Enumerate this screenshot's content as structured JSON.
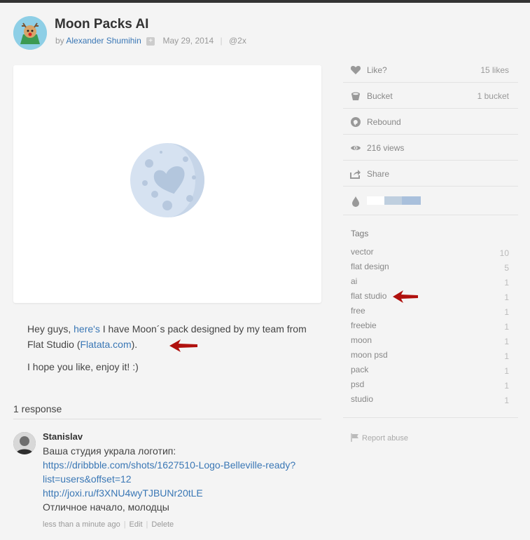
{
  "shot": {
    "title": "Moon Packs AI",
    "by_label": "by",
    "author": "Alexander Shumihin",
    "date": "May 29, 2014",
    "resolution": "@2x"
  },
  "description": {
    "p1_before": "Hey guys, ",
    "p1_link": "here's",
    "p1_middle": " I have Moon´s pack designed by my team from Flat Studio (",
    "p1_link2": "Flatata.com",
    "p1_after": ").",
    "p2": "I hope you like, enjoy it! :)"
  },
  "responses": {
    "count_label": "1 response",
    "comment": {
      "name": "Stanislav",
      "line1": "Ваша студия украла логотип:",
      "link1a": "https://dribbble.com/shots/1627510-Logo-Belleville-ready?",
      "link1b": "list=users&offset=12",
      "link2": "http://joxi.ru/f3XNU4wyTJBUNr20tLE",
      "line2": "Отличное начало, молодцы",
      "time": "less than a minute ago",
      "edit": "Edit",
      "delete": "Delete"
    }
  },
  "sidebar": {
    "like": {
      "label": "Like?",
      "value": "15 likes",
      "icon": "heart-icon"
    },
    "bucket": {
      "label": "Bucket",
      "value": "1 bucket",
      "icon": "bucket-icon"
    },
    "rebound": {
      "label": "Rebound",
      "icon": "rebound-icon"
    },
    "views": {
      "label": "216 views",
      "icon": "eye-icon"
    },
    "share": {
      "label": "Share",
      "icon": "share-icon"
    },
    "colors": [
      "#ffffff",
      "#bfcfdf",
      "#a9c0dc"
    ],
    "tags_title": "Tags",
    "tags": [
      {
        "name": "vector",
        "count": "10"
      },
      {
        "name": "flat design",
        "count": "5"
      },
      {
        "name": "ai",
        "count": "1"
      },
      {
        "name": "flat studio",
        "count": "1"
      },
      {
        "name": "free",
        "count": "1"
      },
      {
        "name": "freebie",
        "count": "1"
      },
      {
        "name": "moon",
        "count": "1"
      },
      {
        "name": "moon psd",
        "count": "1"
      },
      {
        "name": "pack",
        "count": "1"
      },
      {
        "name": "psd",
        "count": "1"
      },
      {
        "name": "studio",
        "count": "1"
      }
    ],
    "report": "Report abuse"
  },
  "colors": {
    "link": "#3a77b5",
    "annotation_arrow": "#b0110e"
  }
}
